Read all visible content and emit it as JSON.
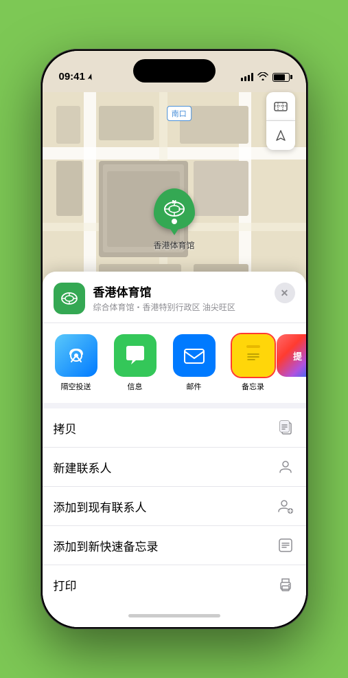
{
  "statusBar": {
    "time": "09:41",
    "timeIcon": "location-arrow-icon"
  },
  "map": {
    "label": "南口",
    "controls": {
      "mapType": "🗺",
      "location": "⬆"
    }
  },
  "venue": {
    "name": "香港体育馆",
    "subtitle": "综合体育馆・香港特别行政区 油尖旺区",
    "closeLabel": "✕"
  },
  "shareRow": [
    {
      "id": "airdrop",
      "label": "隔空投送",
      "selected": false
    },
    {
      "id": "messages",
      "label": "信息",
      "selected": false
    },
    {
      "id": "mail",
      "label": "邮件",
      "selected": false
    },
    {
      "id": "notes",
      "label": "备忘录",
      "selected": true
    },
    {
      "id": "more",
      "label": "提",
      "selected": false
    }
  ],
  "actionItems": [
    {
      "id": "copy",
      "label": "拷贝",
      "icon": "copy"
    },
    {
      "id": "new-contact",
      "label": "新建联系人",
      "icon": "person"
    },
    {
      "id": "add-contact",
      "label": "添加到现有联系人",
      "icon": "person-add"
    },
    {
      "id": "quick-note",
      "label": "添加到新快速备忘录",
      "icon": "quick-note"
    },
    {
      "id": "print",
      "label": "打印",
      "icon": "print"
    }
  ]
}
